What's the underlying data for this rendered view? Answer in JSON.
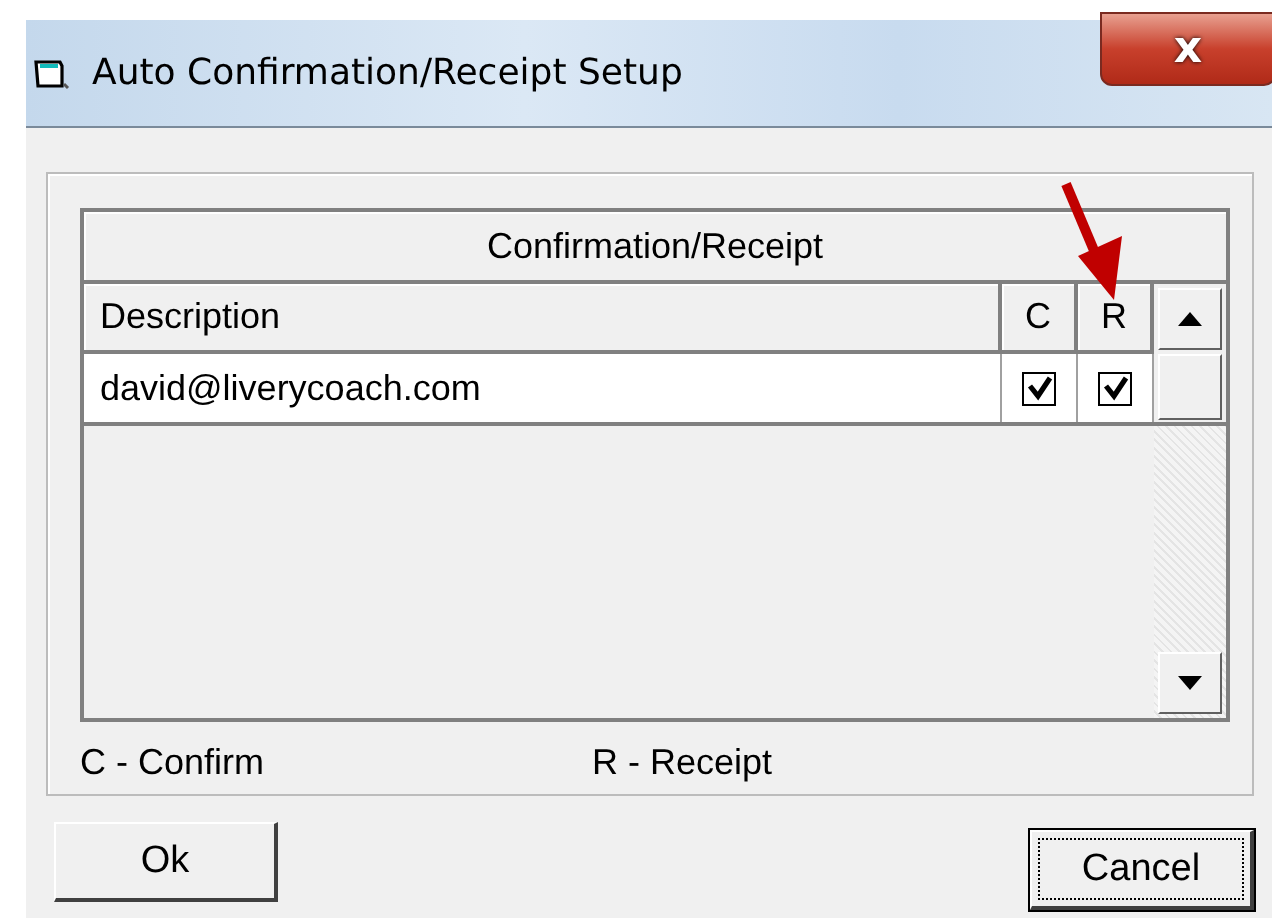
{
  "window": {
    "title": "Auto Confirmation/Receipt Setup",
    "close": "x"
  },
  "grid": {
    "caption": "Confirmation/Receipt",
    "columns": [
      "Description",
      "C",
      "R"
    ],
    "rows": [
      {
        "description": "david@liverycoach.com",
        "confirm": true,
        "receipt": true
      }
    ]
  },
  "legend": [
    "C - Confirm",
    "R - Receipt"
  ],
  "buttons": [
    {
      "label": "Ok",
      "focused": false
    },
    {
      "label": "Cancel",
      "focused": true
    }
  ]
}
